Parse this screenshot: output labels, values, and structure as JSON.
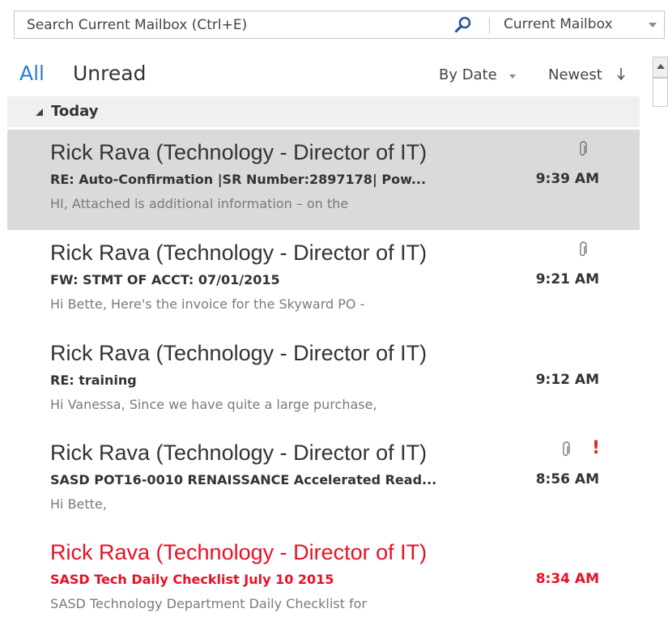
{
  "search": {
    "placeholder": "Search Current Mailbox (Ctrl+E)",
    "icon": "search-icon",
    "scope_label": "Current Mailbox"
  },
  "filters": {
    "all_label": "All",
    "unread_label": "Unread",
    "active": "All"
  },
  "sort": {
    "by_label": "By Date",
    "order_label": "Newest"
  },
  "group": {
    "label": "Today"
  },
  "colors": {
    "accent": "#2b7cd3",
    "selected_row": "#dadada",
    "group_header": "#f0f0f0",
    "flagged_text": "#e81123",
    "importance": "#d52b1e"
  },
  "messages": [
    {
      "sender": "Rick Rava (Technology - Director of IT)",
      "subject": "RE: Auto-Confirmation  |SR Number:2897178| Pow...",
      "time": "9:39 AM",
      "preview": "HI,  Attached is additional information – on the",
      "has_attachment": true,
      "high_importance": false,
      "selected": true,
      "flagged_red": false
    },
    {
      "sender": "Rick Rava (Technology - Director of IT)",
      "subject": "FW: STMT OF ACCT: 07/01/2015",
      "time": "9:21 AM",
      "preview": "Hi Bette,  Here's the invoice for the Skyward PO -",
      "has_attachment": true,
      "high_importance": false,
      "selected": false,
      "flagged_red": false
    },
    {
      "sender": "Rick Rava (Technology - Director of IT)",
      "subject": "RE: training",
      "time": "9:12 AM",
      "preview": "Hi Vanessa,  Since we have quite a large purchase,",
      "has_attachment": false,
      "high_importance": false,
      "selected": false,
      "flagged_red": false
    },
    {
      "sender": "Rick Rava (Technology - Director of IT)",
      "subject": "SASD POT16-0010 RENAISSANCE Accelerated Read...",
      "time": "8:56 AM",
      "preview": "Hi Bette,",
      "has_attachment": true,
      "high_importance": true,
      "importance_glyph": "!",
      "selected": false,
      "flagged_red": false
    },
    {
      "sender": "Rick Rava (Technology - Director of IT)",
      "subject": "SASD Tech Daily Checklist July 10 2015",
      "time": "8:34 AM",
      "preview": "SASD Technology Department Daily Checklist for",
      "has_attachment": false,
      "high_importance": false,
      "selected": false,
      "flagged_red": true
    }
  ]
}
